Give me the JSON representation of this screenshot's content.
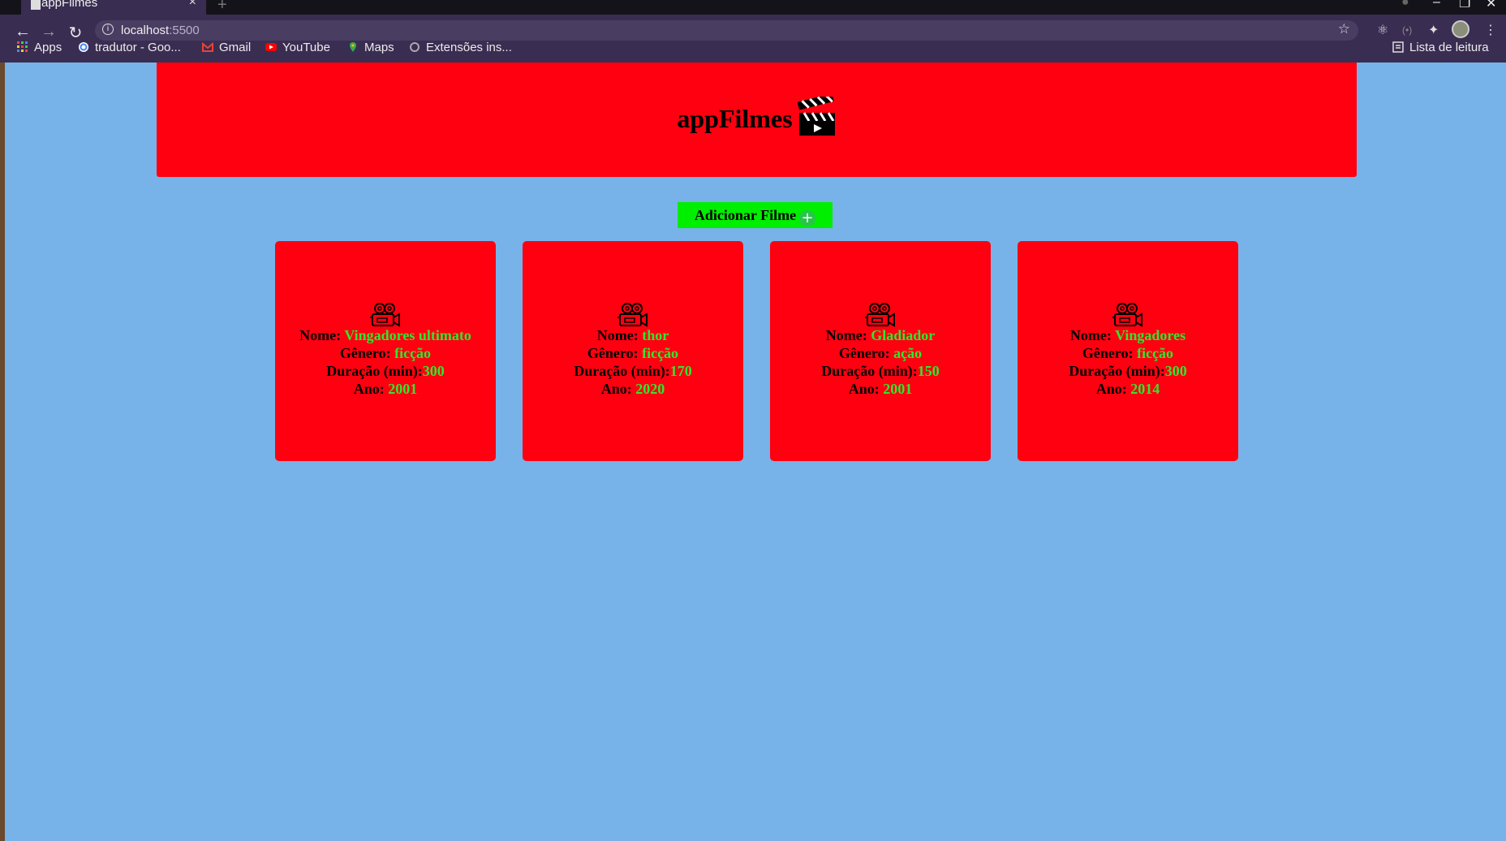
{
  "browser": {
    "tab_title": "appFilmes",
    "tab_close": "×",
    "new_tab": "+",
    "url_host": "localhost",
    "url_port": ":5500",
    "bookmarks": [
      {
        "label": "Apps"
      },
      {
        "label": "tradutor - Goo..."
      },
      {
        "label": "Gmail"
      },
      {
        "label": "YouTube"
      },
      {
        "label": "Maps"
      },
      {
        "label": "Extensões ins..."
      }
    ],
    "reading_list": "Lista de leitura"
  },
  "colors": {
    "page_bg": "#77b3e9",
    "header_bg": "#ff0010",
    "card_bg": "#ff0010",
    "button_bg": "#00ee00",
    "value_text": "#2ee82e"
  },
  "header": {
    "title": "appFilmes",
    "icon": "clapperboard-icon"
  },
  "add_button": {
    "label": "Adicionar Filme",
    "icon": "plus-circle-icon"
  },
  "labels": {
    "name": "Nome: ",
    "genre": "Gênero: ",
    "duration": "Duração (min):",
    "year": "Ano: "
  },
  "movies": [
    {
      "name": "Vingadores ultimato",
      "genre": "ficção",
      "duration": "300",
      "year": "2001"
    },
    {
      "name": "thor",
      "genre": "ficção",
      "duration": "170",
      "year": "2020"
    },
    {
      "name": "Gladiador",
      "genre": "ação",
      "duration": "150",
      "year": "2001"
    },
    {
      "name": "Vingadores",
      "genre": "ficção",
      "duration": "300",
      "year": "2014"
    }
  ]
}
